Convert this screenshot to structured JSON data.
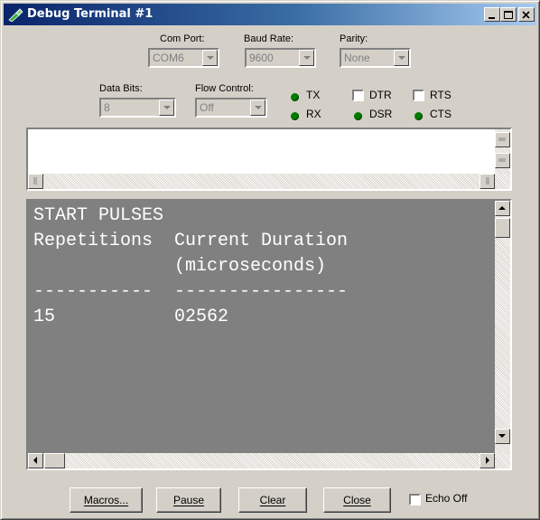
{
  "window": {
    "title": "Debug Terminal #1"
  },
  "settings": {
    "com_port": {
      "label": "Com Port:",
      "value": "COM6"
    },
    "baud_rate": {
      "label": "Baud Rate:",
      "value": "9600"
    },
    "parity": {
      "label": "Parity:",
      "value": "None"
    },
    "data_bits": {
      "label": "Data Bits:",
      "value": "8"
    },
    "flow_control": {
      "label": "Flow Control:",
      "value": "Off"
    }
  },
  "indicators": {
    "tx": "TX",
    "rx": "RX",
    "dtr": "DTR",
    "rts": "RTS",
    "dsr": "DSR",
    "cts": "CTS",
    "led_color": "#007d00"
  },
  "transmit_pane": {
    "text": ""
  },
  "receive_pane": {
    "lines": [
      "START PULSES",
      "Repetitions  Current Duration",
      "             (microseconds)",
      "-----------  ----------------",
      "15           02562"
    ],
    "background": "#808080",
    "foreground": "#ffffff"
  },
  "buttons": {
    "macros": "Macros...",
    "pause": "Pause",
    "clear": "Clear",
    "close": "Close",
    "echo_off": "Echo Off"
  }
}
